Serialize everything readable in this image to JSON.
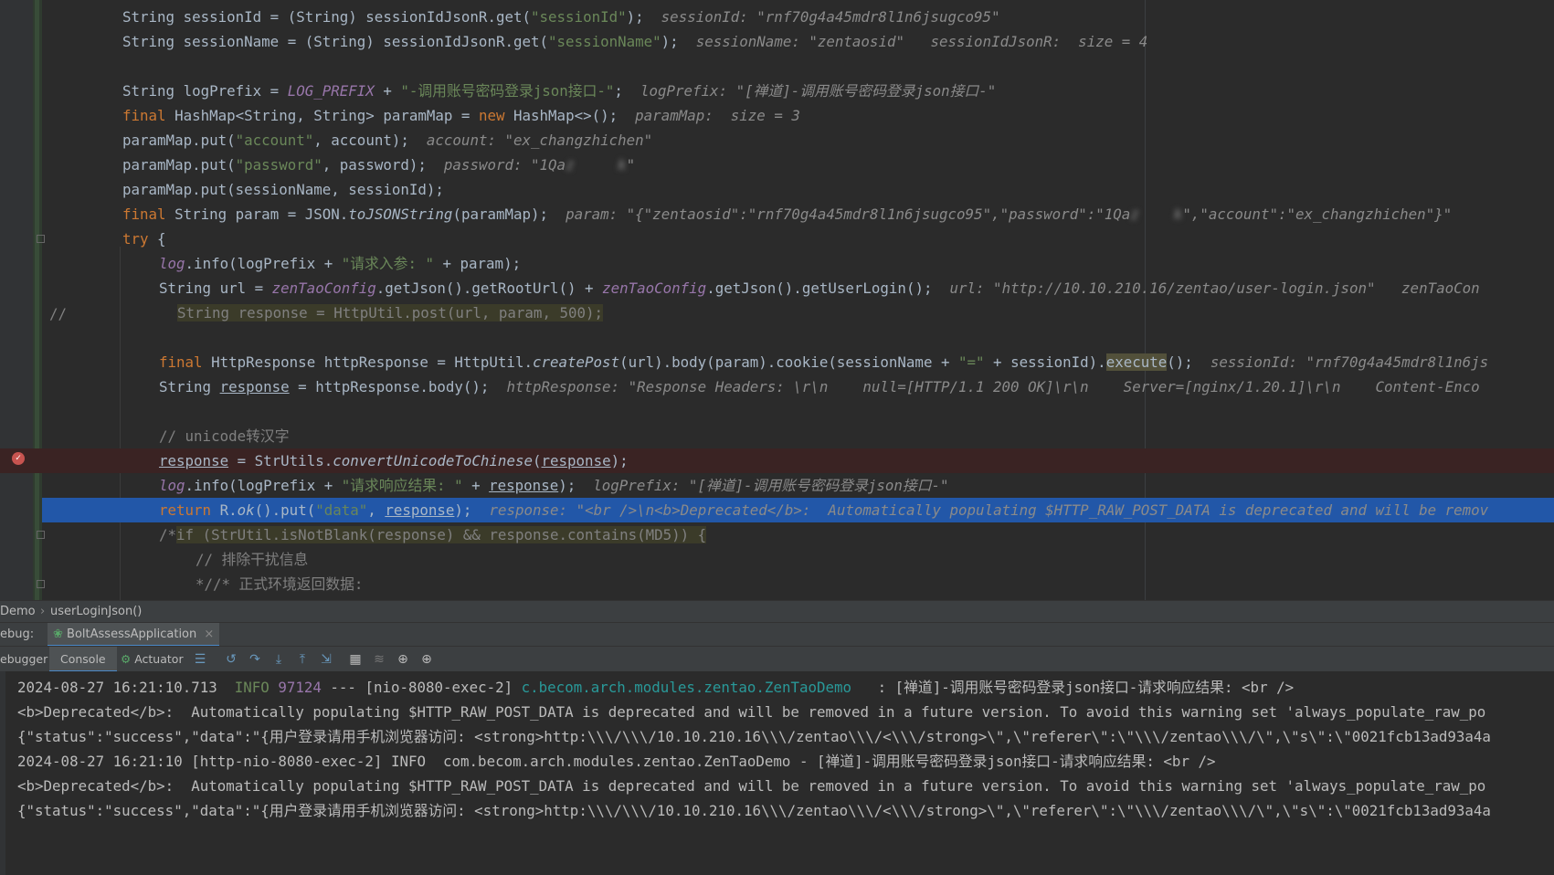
{
  "editor": {
    "lines": [
      {
        "id": "l1",
        "segments": [
          [
            "String sessionId = (String) sessionIdJsonR.get(",
            ""
          ],
          [
            "\"sessionId\"",
            "str"
          ],
          [
            ");  ",
            ""
          ],
          [
            "sessionId: \"rnf70g4a45mdr8l1n6jsugco95\"",
            "hint"
          ]
        ]
      },
      {
        "id": "l2",
        "segments": [
          [
            "String sessionName = (String) sessionIdJsonR.get(",
            ""
          ],
          [
            "\"sessionName\"",
            "str"
          ],
          [
            ");  ",
            ""
          ],
          [
            "sessionName: \"zentaosid\"   sessionIdJsonR:  size = 4",
            "hint"
          ]
        ]
      },
      {
        "id": "l4",
        "segments": [
          [
            "String logPrefix = ",
            ""
          ],
          [
            "LOG_PREFIX",
            "fld"
          ],
          [
            " + ",
            ""
          ],
          [
            "\"-调用账号密码登录json接口-\"",
            "str"
          ],
          [
            ";  ",
            ""
          ],
          [
            "logPrefix: \"[禅道]-调用账号密码登录json接口-\"",
            "hint"
          ]
        ]
      },
      {
        "id": "l5",
        "segments": [
          [
            "final ",
            "kw"
          ],
          [
            "HashMap<String, String> paramMap = ",
            ""
          ],
          [
            "new ",
            "kw"
          ],
          [
            "HashMap<>();  ",
            ""
          ],
          [
            "paramMap:  size = 3",
            "hint"
          ]
        ]
      },
      {
        "id": "l6",
        "segments": [
          [
            "paramMap.put(",
            ""
          ],
          [
            "\"account\"",
            "str"
          ],
          [
            ", account);  ",
            ""
          ],
          [
            "account: \"ex_changzhichen\"",
            "hint"
          ]
        ]
      },
      {
        "id": "l7",
        "segments": [
          [
            "paramMap.put(",
            ""
          ],
          [
            "\"password\"",
            "str"
          ],
          [
            ", password);  ",
            ""
          ],
          [
            "password: \"1Qa",
            "hint"
          ],
          [
            "z     k",
            "hint blurred"
          ],
          [
            "\"",
            "hint"
          ]
        ]
      },
      {
        "id": "l8",
        "segments": [
          [
            "paramMap.put(sessionName, sessionId);",
            ""
          ]
        ]
      },
      {
        "id": "l9",
        "segments": [
          [
            "final ",
            "kw"
          ],
          [
            "String param = JSON.",
            ""
          ],
          [
            "toJSONString",
            "ital"
          ],
          [
            "(paramMap);  ",
            ""
          ],
          [
            "param: \"{\"zentaosid\":\"rnf70g4a45mdr8l1n6jsugco95\",\"password\":\"1Qa",
            "hint"
          ],
          [
            "z    k",
            "hint blurred"
          ],
          [
            "\",\"account\":\"ex_changzhichen\"}\"",
            "hint"
          ]
        ]
      },
      {
        "id": "l10",
        "segments": [
          [
            "try ",
            "kw"
          ],
          [
            "{",
            ""
          ]
        ]
      },
      {
        "id": "l11",
        "segments": [
          [
            "log",
            "fld"
          ],
          [
            ".info(logPrefix + ",
            ""
          ],
          [
            "\"请求入参: \"",
            "str"
          ],
          [
            " + param);",
            ""
          ]
        ]
      },
      {
        "id": "l12",
        "segments": [
          [
            "String url = ",
            ""
          ],
          [
            "zenTaoConfig",
            "fld"
          ],
          [
            ".getJson().getRootUrl() + ",
            ""
          ],
          [
            "zenTaoConfig",
            "fld"
          ],
          [
            ".getJson().getUserLogin();  ",
            ""
          ],
          [
            "url: \"http://10.10.210.16/zentao/user-login.json\"   zenTaoCon",
            "hint"
          ]
        ]
      },
      {
        "id": "l13",
        "segments": [
          [
            "String response = HttpUtil.post(url, param, 500);",
            "cmt hl"
          ]
        ]
      },
      {
        "id": "l15",
        "segments": [
          [
            "final ",
            "kw"
          ],
          [
            "HttpResponse httpResponse = HttpUtil.",
            ""
          ],
          [
            "createPost",
            "ital"
          ],
          [
            "(url).body(param).cookie(sessionName + ",
            ""
          ],
          [
            "\"=\"",
            "str"
          ],
          [
            " + sessionId).",
            ""
          ],
          [
            "execute",
            "hl2"
          ],
          [
            "();  ",
            ""
          ],
          [
            "sessionId: \"rnf70g4a45mdr8l1n6js",
            "hint"
          ]
        ]
      },
      {
        "id": "l16",
        "segments": [
          [
            "String ",
            ""
          ],
          [
            "response",
            "ul"
          ],
          [
            " = httpResponse.body();  ",
            ""
          ],
          [
            "httpResponse: \"Response Headers: \\r\\n    null=[HTTP/1.1 200 OK]\\r\\n    Server=[nginx/1.20.1]\\r\\n    Content-Enco",
            "hint"
          ]
        ]
      },
      {
        "id": "l18",
        "segments": [
          [
            "// unicode转汉字",
            "cmt"
          ]
        ]
      },
      {
        "id": "l19",
        "segments": [
          [
            "response",
            "ul"
          ],
          [
            " = StrUtils.",
            ""
          ],
          [
            "convertUnicodeToChinese",
            "ital"
          ],
          [
            "(",
            ""
          ],
          [
            "response",
            "ul"
          ],
          [
            ");",
            ""
          ]
        ]
      },
      {
        "id": "l20",
        "segments": [
          [
            "log",
            "fld"
          ],
          [
            ".info(logPrefix + ",
            ""
          ],
          [
            "\"请求响应结果: \"",
            "str"
          ],
          [
            " + ",
            ""
          ],
          [
            "response",
            "ul"
          ],
          [
            ");  ",
            ""
          ],
          [
            "logPrefix: \"[禅道]-调用账号密码登录json接口-\"",
            "hint"
          ]
        ]
      },
      {
        "id": "l21",
        "segments": [
          [
            "return ",
            "kw"
          ],
          [
            "R.",
            ""
          ],
          [
            "ok",
            "ital"
          ],
          [
            "().put(",
            ""
          ],
          [
            "\"data\"",
            "str"
          ],
          [
            ", ",
            ""
          ],
          [
            "response",
            "ul"
          ],
          [
            ");  ",
            ""
          ],
          [
            "response: \"<br />\\n<b>Deprecated</b>:  Automatically populating $HTTP_RAW_POST_DATA is deprecated and will be remov",
            "hint"
          ]
        ]
      },
      {
        "id": "l22",
        "segments": [
          [
            "/*",
            "cmt"
          ],
          [
            "if (StrUtil.isNotBlank(response) && response.contains(MD5)) {",
            "cmt hl"
          ]
        ]
      },
      {
        "id": "l23",
        "segments": [
          [
            "// 排除干扰信息",
            "cmt"
          ]
        ]
      },
      {
        "id": "l24",
        "segments": [
          [
            "*//* 正式环境返回数据:",
            "cmt"
          ]
        ]
      }
    ],
    "comment_marker": "//"
  },
  "breadcrumb": {
    "items": [
      "Demo",
      "userLoginJson()"
    ]
  },
  "debug": {
    "label": "ebug:",
    "config_name": "BoltAssessApplication"
  },
  "toolbar": {
    "debugger_tab": "ebugger",
    "console_tab": "Console",
    "actuator_tab": "Actuator"
  },
  "console": {
    "lines": [
      {
        "segments": [
          [
            "2024-08-27 16:21:10.713  ",
            ""
          ],
          [
            "INFO",
            "c-info"
          ],
          [
            " ",
            ""
          ],
          [
            "97124",
            "c-pid"
          ],
          [
            " --- [nio-8080-exec-2] ",
            ""
          ],
          [
            "c.becom.arch.modules.zentao.ZenTaoDemo",
            "c-class"
          ],
          [
            "   : [禅道]-调用账号密码登录json接口-请求响应结果: <br />",
            ""
          ]
        ]
      },
      {
        "segments": [
          [
            "<b>Deprecated</b>:  Automatically populating $HTTP_RAW_POST_DATA is deprecated and will be removed in a future version. To avoid this warning set 'always_populate_raw_po",
            ""
          ]
        ]
      },
      {
        "segments": [
          [
            "{\"status\":\"success\",\"data\":\"{用户登录请用手机浏览器访问: <strong>http:\\\\\\/\\\\\\/10.10.210.16\\\\\\/zentao\\\\\\/<\\\\\\/strong>\\\",\\\"referer\\\":\\\"\\\\\\/zentao\\\\\\/\\\",\\\"s\\\":\\\"0021fcb13ad93a4a",
            ""
          ]
        ]
      },
      {
        "segments": [
          [
            "2024-08-27 16:21:10 [http-nio-8080-exec-2] INFO  com.becom.arch.modules.zentao.ZenTaoDemo - [禅道]-调用账号密码登录json接口-请求响应结果: <br />",
            ""
          ]
        ]
      },
      {
        "segments": [
          [
            "<b>Deprecated</b>:  Automatically populating $HTTP_RAW_POST_DATA is deprecated and will be removed in a future version. To avoid this warning set 'always_populate_raw_po",
            ""
          ]
        ]
      },
      {
        "segments": [
          [
            "{\"status\":\"success\",\"data\":\"{用户登录请用手机浏览器访问: <strong>http:\\\\\\/\\\\\\/10.10.210.16\\\\\\/zentao\\\\\\/<\\\\\\/strong>\\\",\\\"referer\\\":\\\"\\\\\\/zentao\\\\\\/\\\",\\\"s\\\":\\\"0021fcb13ad93a4a",
            ""
          ]
        ]
      }
    ]
  }
}
